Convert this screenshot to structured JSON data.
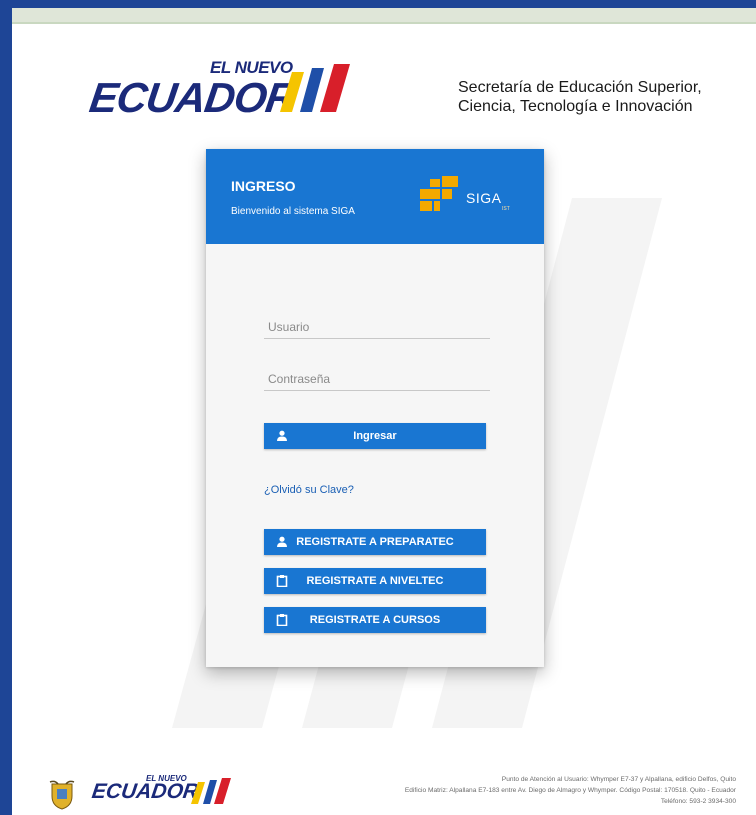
{
  "header": {
    "brand_small": "EL NUEVO",
    "brand_large": "ECUADOR",
    "secretaria_line1": "Secretaría de Educación Superior,",
    "secretaria_line2": "Ciencia, Tecnología e Innovación"
  },
  "card": {
    "title": "INGRESO",
    "subtitle": "Bienvenido al sistema SIGA",
    "logo_text": "SIGA",
    "logo_small": "IST"
  },
  "form": {
    "user_placeholder": "Usuario",
    "password_placeholder": "Contraseña",
    "login_button": "Ingresar",
    "forgot_link": "¿Olvidó su Clave?"
  },
  "register": {
    "preparatec": "REGISTRATE A PREPARATEC",
    "niveltec": "REGISTRATE A NIVELTEC",
    "cursos": "REGISTRATE A CURSOS"
  },
  "footer": {
    "brand_small": "EL NUEVO",
    "brand_large": "ECUADOR",
    "line1": "Punto de Atención al Usuario: Whymper E7-37 y Alpallana, edificio Delfos, Quito",
    "line2": "Edificio Matriz: Alpallana E7-183 entre Av. Diego de Almagro y Whymper. Código Postal: 170518. Quito - Ecuador",
    "line3": "Teléfono: 593-2 3934-300"
  },
  "colors": {
    "primary": "#1976d2",
    "border": "#1e4596",
    "brand_navy": "#1b2a7a",
    "flag_yellow": "#f5c400",
    "flag_blue": "#1f4fa8",
    "flag_red": "#d81f2a"
  },
  "icons": {
    "login": "person-icon",
    "preparatec": "person-icon",
    "niveltec": "clipboard-icon",
    "cursos": "clipboard-icon"
  }
}
